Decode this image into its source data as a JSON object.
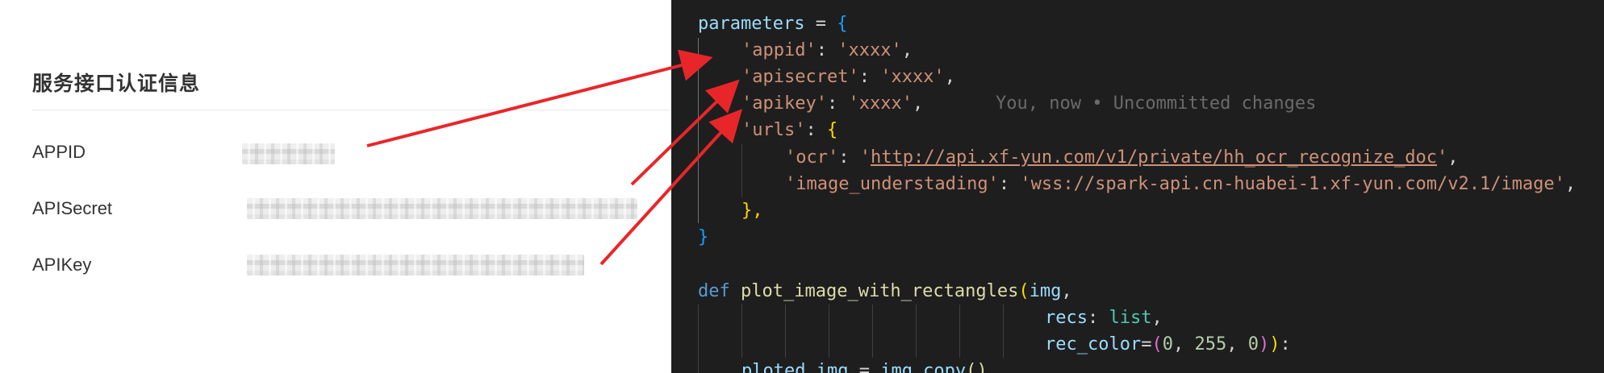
{
  "auth_panel": {
    "title": "服务接口认证信息",
    "rows": [
      {
        "label": "APPID",
        "value_masked": true
      },
      {
        "label": "APISecret",
        "value_masked": true
      },
      {
        "label": "APIKey",
        "value_masked": true
      }
    ]
  },
  "editor": {
    "params_var": "parameters",
    "assign": " = ",
    "open_brace": "{",
    "appid_key": "'appid'",
    "appid_val": "'xxxx'",
    "apisecret_key": "'apisecret'",
    "apisecret_val": "'xxxx'",
    "apikey_key": "'apikey'",
    "apikey_val": "'xxxx'",
    "blame_text": "You, now • Uncommitted changes",
    "urls_key": "'urls'",
    "ocr_key": "'ocr'",
    "ocr_url": "http://api.xf-yun.com/v1/private/hh_ocr_recognize_doc",
    "image_key": "'image_understading'",
    "image_val": "'wss://spark-api.cn-huabei-1.xf-yun.com/v2.1/image'",
    "colon": ": ",
    "comma": ",",
    "inner_close": "},",
    "outer_close": "}",
    "def_kw": "def",
    "fn_name": "plot_image_with_rectangles",
    "param_img": "img",
    "param_recs": "recs",
    "type_list": "list",
    "param_rec_color": "rec_color",
    "num_0a": "0",
    "num_255": "255",
    "num_0b": "0",
    "last_line_var": "ploted_img",
    "last_line_rhs": "img.copy",
    "paren_pair": "()"
  },
  "colors": {
    "editor_bg": "#1e1e1e",
    "arrow": "#e8262a",
    "string": "#ce9178",
    "variable": "#9cdcfe",
    "keyword": "#569cd6",
    "function": "#dcdcaa"
  }
}
